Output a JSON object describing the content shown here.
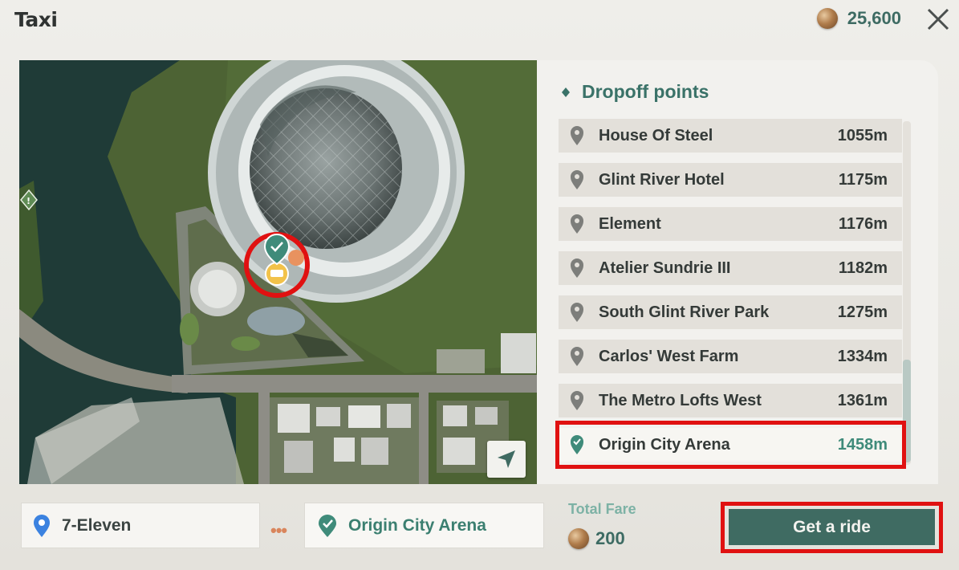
{
  "window": {
    "title": "Taxi"
  },
  "currency": {
    "balance": "25,600",
    "icon": "coin-icon"
  },
  "close": {
    "icon": "close-icon"
  },
  "map": {
    "alert_icon": "alert-marker-icon",
    "destination_marker": "destination-check-marker-icon",
    "taxi_marker": "taxi-marker-icon",
    "locate_icon": "navigation-arrow-icon"
  },
  "dropoff": {
    "title": "Dropoff points",
    "items": [
      {
        "name": "House Of Steel",
        "distance": "1055m",
        "selected": false
      },
      {
        "name": "Glint River Hotel",
        "distance": "1175m",
        "selected": false
      },
      {
        "name": "Element",
        "distance": "1176m",
        "selected": false
      },
      {
        "name": "Atelier Sundrie III",
        "distance": "1182m",
        "selected": false
      },
      {
        "name": "South Glint River Park",
        "distance": "1275m",
        "selected": false
      },
      {
        "name": "Carlos' West Farm",
        "distance": "1334m",
        "selected": false
      },
      {
        "name": "The Metro Lofts West",
        "distance": "1361m",
        "selected": false
      },
      {
        "name": "Origin City Arena",
        "distance": "1458m",
        "selected": true
      }
    ]
  },
  "route": {
    "from": "7-Eleven",
    "to": "Origin City Arena",
    "separator": "•••"
  },
  "fare": {
    "label": "Total Fare",
    "value": "200"
  },
  "action": {
    "label": "Get a ride"
  },
  "colors": {
    "accent": "#3f6b62",
    "selected_text": "#3f8b7a",
    "highlight": "#e01111"
  }
}
